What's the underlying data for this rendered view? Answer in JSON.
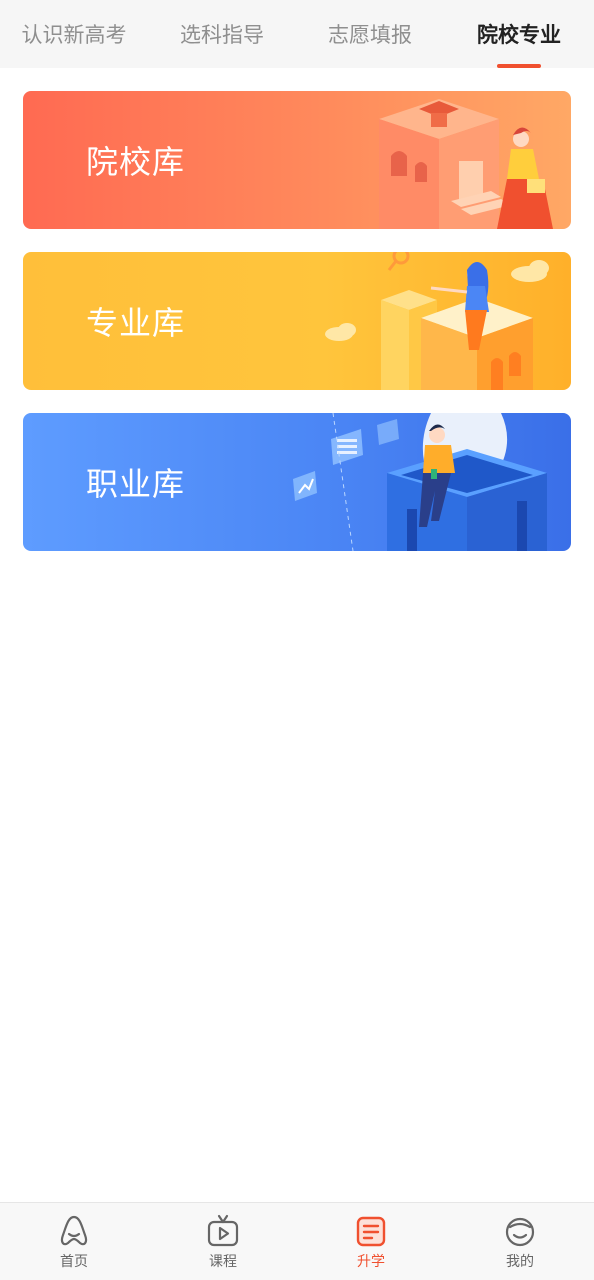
{
  "top_tabs": [
    {
      "label": "认识新高考",
      "active": false
    },
    {
      "label": "选科指导",
      "active": false
    },
    {
      "label": "志愿填报",
      "active": false
    },
    {
      "label": "院校专业",
      "active": true
    }
  ],
  "accent_color": "#f0502f",
  "cards": [
    {
      "label": "院校库",
      "illustration": "school-building-graduate-icon"
    },
    {
      "label": "专业库",
      "illustration": "person-sitting-on-blocks-icon"
    },
    {
      "label": "职业库",
      "illustration": "person-sitting-on-box-with-charts-icon"
    }
  ],
  "bottom_nav": [
    {
      "label": "首页",
      "icon": "home-icon",
      "active": false
    },
    {
      "label": "课程",
      "icon": "tv-play-icon",
      "active": false
    },
    {
      "label": "升学",
      "icon": "document-list-icon",
      "active": true
    },
    {
      "label": "我的",
      "icon": "smiley-face-icon",
      "active": false
    }
  ]
}
